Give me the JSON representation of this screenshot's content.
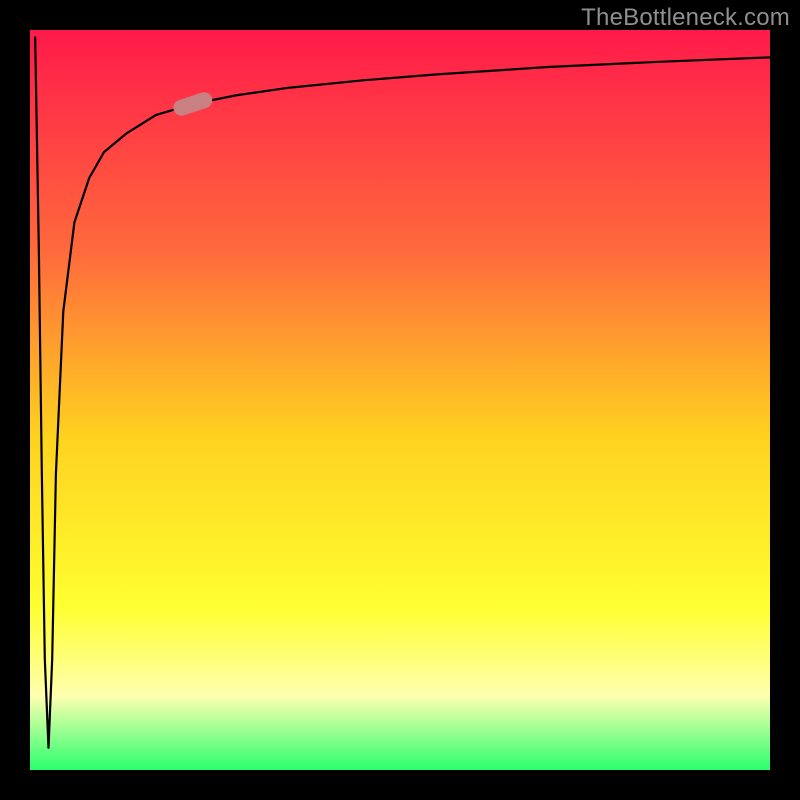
{
  "attribution": "TheBottleneck.com",
  "colors": {
    "frame_bg": "#000000",
    "gradient_top": "#ff1a4a",
    "gradient_mid1": "#ff6a3c",
    "gradient_mid2": "#ffd21f",
    "gradient_mid3": "#ffff30",
    "gradient_band": "#ffffb0",
    "gradient_bottom": "#2aff6e",
    "curve": "#000000",
    "marker": "#c98080"
  },
  "chart_data": {
    "type": "line",
    "title": "",
    "xlabel": "",
    "ylabel": "",
    "xlim": [
      0,
      100
    ],
    "ylim": [
      0,
      100
    ],
    "grid": false,
    "legend": false,
    "series": [
      {
        "name": "curve",
        "x": [
          0.7,
          1.2,
          1.6,
          2.0,
          2.5,
          3.0,
          3.5,
          4.5,
          6.0,
          8.0,
          10.0,
          13.0,
          17.0,
          22.0,
          28.0,
          35.0,
          45.0,
          55.0,
          70.0,
          85.0,
          100.0
        ],
        "y": [
          99.0,
          70.0,
          40.0,
          15.0,
          3.0,
          15.0,
          40.0,
          62.0,
          74.0,
          80.0,
          83.5,
          86.0,
          88.5,
          90.0,
          91.2,
          92.2,
          93.2,
          94.0,
          95.0,
          95.7,
          96.3
        ]
      }
    ],
    "marker": {
      "x": 22.0,
      "y": 90.0,
      "angle_deg": -18
    }
  }
}
